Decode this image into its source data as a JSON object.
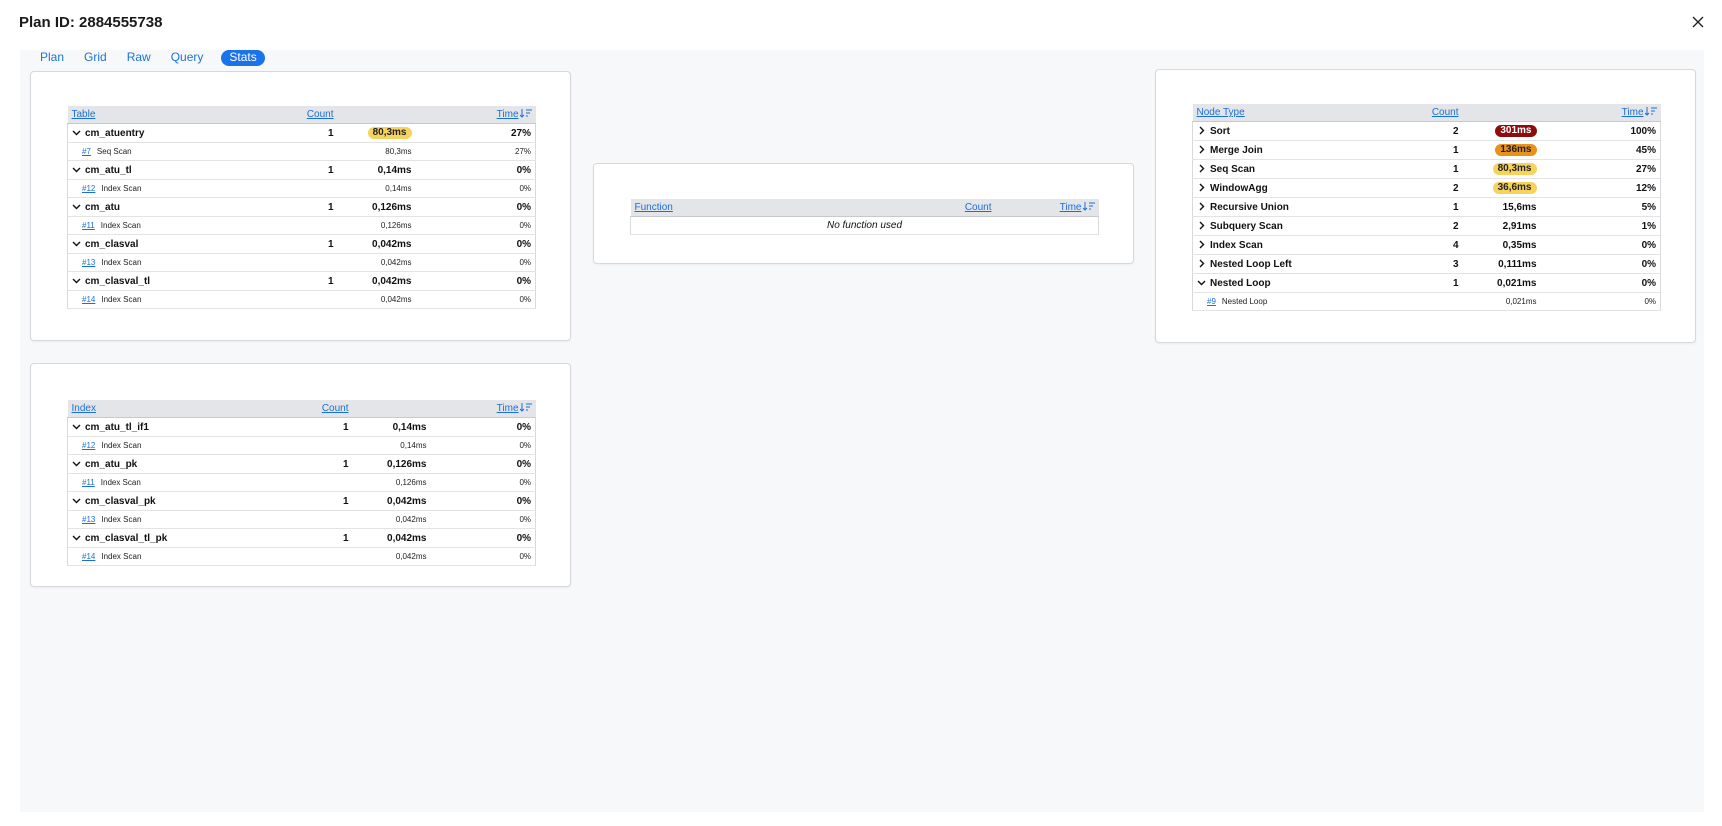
{
  "header": {
    "title": "Plan ID: 2884555738"
  },
  "tabs": [
    {
      "label": "Plan"
    },
    {
      "label": "Grid"
    },
    {
      "label": "Raw"
    },
    {
      "label": "Query"
    },
    {
      "label": "Stats",
      "active": true
    }
  ],
  "colors": {
    "accent": "#1a73e8",
    "badge_red": "#8b0d0d",
    "badge_orange": "#e8911c",
    "badge_yellow": "#f6d35c"
  },
  "table_stats": {
    "columns": [
      "Table",
      "Count",
      "Time"
    ],
    "rows": [
      {
        "name": "cm_atuentry",
        "count": "1",
        "time": "80,3ms",
        "pct": "27%",
        "badge": "yellow",
        "sub": {
          "link": "#7",
          "label": "Seq Scan",
          "time": "80,3ms",
          "pct": "27%"
        }
      },
      {
        "name": "cm_atu_tl",
        "count": "1",
        "time": "0,14ms",
        "pct": "0%",
        "sub": {
          "link": "#12",
          "label": "Index Scan",
          "time": "0,14ms",
          "pct": "0%"
        }
      },
      {
        "name": "cm_atu",
        "count": "1",
        "time": "0,126ms",
        "pct": "0%",
        "sub": {
          "link": "#11",
          "label": "Index Scan",
          "time": "0,126ms",
          "pct": "0%"
        }
      },
      {
        "name": "cm_clasval",
        "count": "1",
        "time": "0,042ms",
        "pct": "0%",
        "sub": {
          "link": "#13",
          "label": "Index Scan",
          "time": "0,042ms",
          "pct": "0%"
        }
      },
      {
        "name": "cm_clasval_tl",
        "count": "1",
        "time": "0,042ms",
        "pct": "0%",
        "sub": {
          "link": "#14",
          "label": "Index Scan",
          "time": "0,042ms",
          "pct": "0%"
        }
      }
    ]
  },
  "function_stats": {
    "columns": [
      "Function",
      "Count",
      "Time"
    ],
    "empty": "No function used"
  },
  "node_stats": {
    "columns": [
      "Node Type",
      "Count",
      "Time"
    ],
    "rows": [
      {
        "name": "Sort",
        "count": "2",
        "time": "301ms",
        "pct": "100%",
        "badge": "red",
        "expanded": false
      },
      {
        "name": "Merge Join",
        "count": "1",
        "time": "136ms",
        "pct": "45%",
        "badge": "orange",
        "expanded": false
      },
      {
        "name": "Seq Scan",
        "count": "1",
        "time": "80,3ms",
        "pct": "27%",
        "badge": "yellow",
        "expanded": false
      },
      {
        "name": "WindowAgg",
        "count": "2",
        "time": "36,6ms",
        "pct": "12%",
        "badge": "yellow",
        "expanded": false
      },
      {
        "name": "Recursive Union",
        "count": "1",
        "time": "15,6ms",
        "pct": "5%",
        "expanded": false
      },
      {
        "name": "Subquery Scan",
        "count": "2",
        "time": "2,91ms",
        "pct": "1%",
        "expanded": false
      },
      {
        "name": "Index Scan",
        "count": "4",
        "time": "0,35ms",
        "pct": "0%",
        "expanded": false
      },
      {
        "name": "Nested Loop Left",
        "count": "3",
        "time": "0,111ms",
        "pct": "0%",
        "expanded": false
      },
      {
        "name": "Nested Loop",
        "count": "1",
        "time": "0,021ms",
        "pct": "0%",
        "expanded": true,
        "sub": {
          "link": "#9",
          "label": "Nested Loop",
          "time": "0,021ms",
          "pct": "0%"
        }
      }
    ]
  },
  "index_stats": {
    "columns": [
      "Index",
      "Count",
      "Time"
    ],
    "rows": [
      {
        "name": "cm_atu_tl_if1",
        "count": "1",
        "time": "0,14ms",
        "pct": "0%",
        "sub": {
          "link": "#12",
          "label": "Index Scan",
          "time": "0,14ms",
          "pct": "0%"
        }
      },
      {
        "name": "cm_atu_pk",
        "count": "1",
        "time": "0,126ms",
        "pct": "0%",
        "sub": {
          "link": "#11",
          "label": "Index Scan",
          "time": "0,126ms",
          "pct": "0%"
        }
      },
      {
        "name": "cm_clasval_pk",
        "count": "1",
        "time": "0,042ms",
        "pct": "0%",
        "sub": {
          "link": "#13",
          "label": "Index Scan",
          "time": "0,042ms",
          "pct": "0%"
        }
      },
      {
        "name": "cm_clasval_tl_pk",
        "count": "1",
        "time": "0,042ms",
        "pct": "0%",
        "sub": {
          "link": "#14",
          "label": "Index Scan",
          "time": "0,042ms",
          "pct": "0%"
        }
      }
    ]
  },
  "icons": {
    "close": "close-icon",
    "expand": "chevron-down-icon",
    "collapse": "chevron-right-icon",
    "sort": "sort-desc-icon"
  }
}
